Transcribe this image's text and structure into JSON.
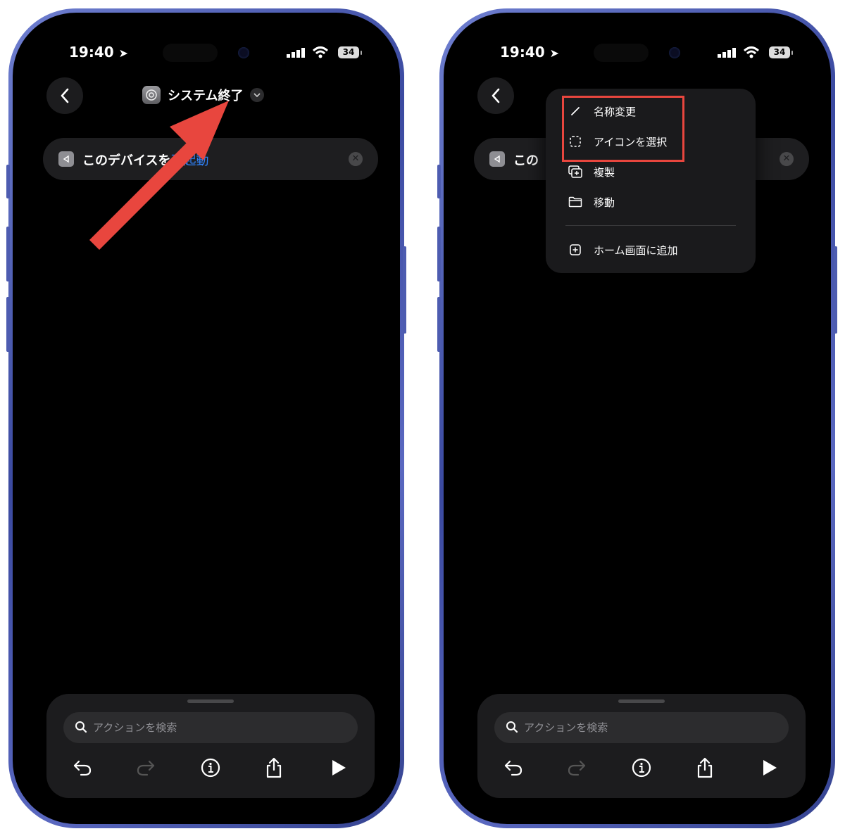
{
  "colors": {
    "accent_blue": "#2f7ff2",
    "highlight_red": "#e8463e",
    "frame_blue": "#4d5cb0"
  },
  "left": {
    "status": {
      "time": "19:40",
      "battery": "34"
    },
    "title": "システム終了",
    "action": {
      "text": "このデバイスを",
      "link": "再起動"
    },
    "search_placeholder": "アクションを検索"
  },
  "right": {
    "status": {
      "time": "19:40",
      "battery": "34"
    },
    "action": {
      "text": "この"
    },
    "search_placeholder": "アクションを検索",
    "menu": [
      {
        "label": "名称変更",
        "icon": "pencil-icon"
      },
      {
        "label": "アイコンを選択",
        "icon": "dashed-square-icon"
      },
      {
        "label": "複製",
        "icon": "duplicate-icon"
      },
      {
        "label": "移動",
        "icon": "folder-icon"
      },
      {
        "label": "ホーム画面に追加",
        "icon": "add-square-icon"
      }
    ]
  }
}
